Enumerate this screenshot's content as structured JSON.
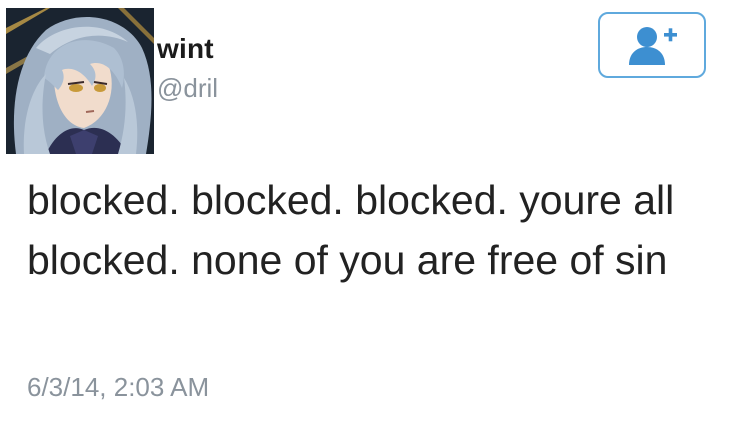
{
  "tweet": {
    "display_name": "wint",
    "handle": "@dril",
    "text": "blocked. blocked. blocked. youre all blocked. none of you are free of sin",
    "timestamp": "6/3/14, 2:03 AM"
  },
  "follow_button": {
    "icon": "add-user-icon",
    "accent_color": "#5fa9dd"
  },
  "avatar": {
    "icon": "profile-avatar-anime-character"
  }
}
